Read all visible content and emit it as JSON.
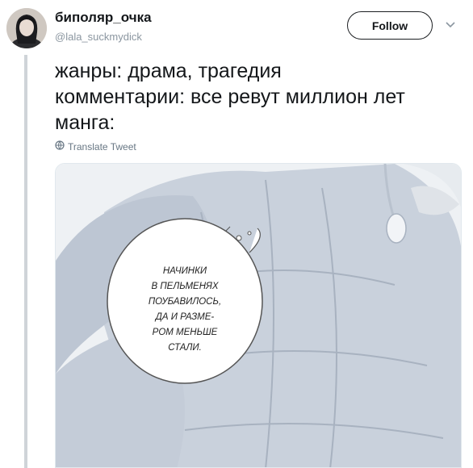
{
  "tweet": {
    "display_name": "биполяр_очка",
    "handle": "@lala_suckmydick",
    "follow_label": "Follow",
    "lines": [
      "жанры: драма, трагедия",
      "комментарии: все ревут миллион лет",
      "манга:"
    ],
    "translate_label": "Translate Tweet"
  },
  "manga": {
    "bubble_lines": [
      "НАЧИНКИ",
      "В ПЕЛЬМЕНЯХ",
      "ПОУБАВИЛОСЬ,",
      "ДА И РАЗМЕ-",
      "РОМ МЕНЬШЕ",
      "СТАЛИ."
    ]
  },
  "icons": {
    "globe": "globe-icon",
    "caret": "chevron-down-icon"
  }
}
